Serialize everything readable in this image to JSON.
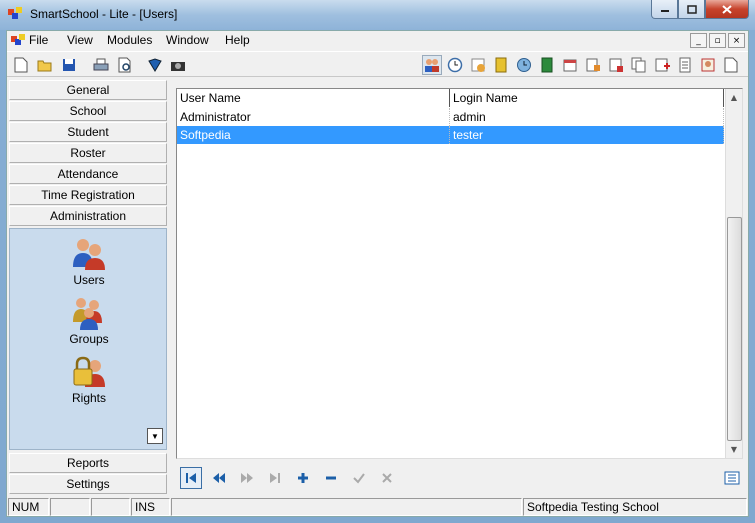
{
  "window": {
    "title": "SmartSchool - Lite - [Users]"
  },
  "menu": {
    "items": [
      "File",
      "View",
      "Modules",
      "Window",
      "Help"
    ]
  },
  "mdi_buttons": [
    "_",
    "▫",
    "×"
  ],
  "sidebar": {
    "top_items": [
      "General",
      "School",
      "Student",
      "Roster",
      "Attendance",
      "Time Registration",
      "Administration"
    ],
    "modules": [
      {
        "label": "Users"
      },
      {
        "label": "Groups"
      },
      {
        "label": "Rights"
      }
    ],
    "bottom_items": [
      "Reports",
      "Settings"
    ]
  },
  "grid": {
    "columns": [
      "User Name",
      "Login Name"
    ],
    "rows": [
      {
        "user_name": "Administrator",
        "login_name": "admin",
        "selected": false
      },
      {
        "user_name": "Softpedia",
        "login_name": "tester",
        "selected": true
      }
    ]
  },
  "status": {
    "num": "NUM",
    "ins": "INS",
    "school": "Softpedia Testing School"
  },
  "colors": {
    "selection": "#3399ff",
    "panel": "#c9dbed",
    "accent": "#1c5fa8"
  }
}
